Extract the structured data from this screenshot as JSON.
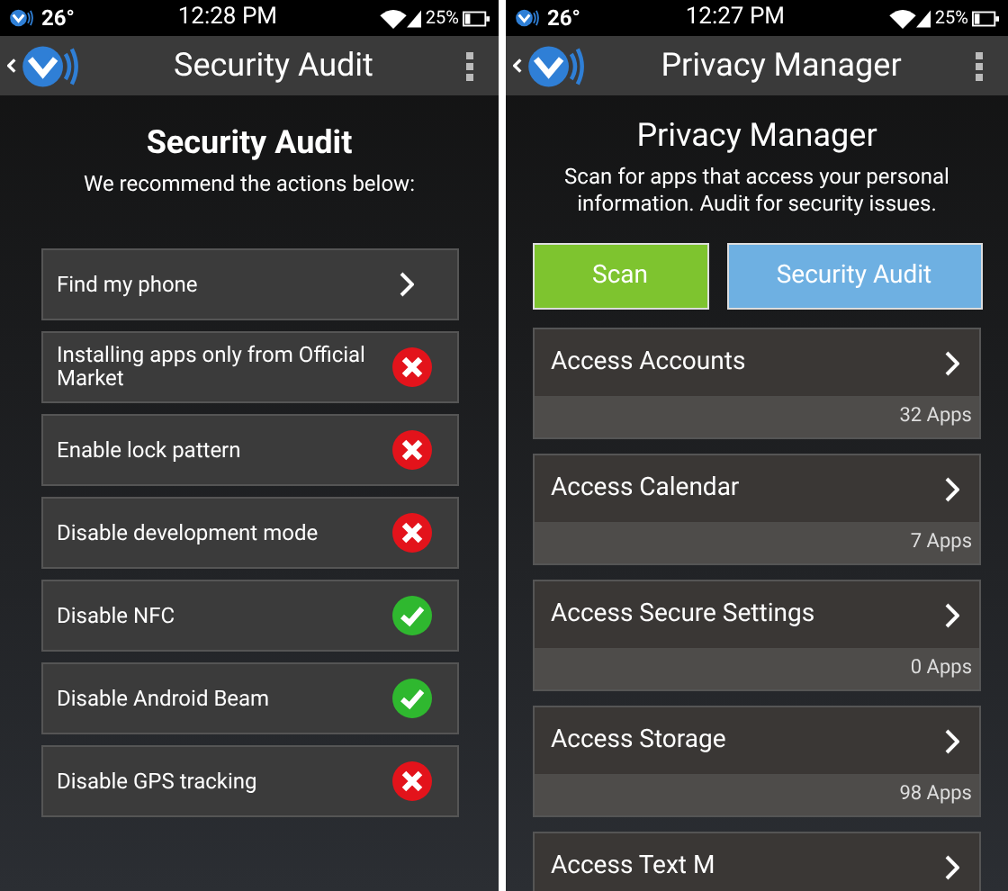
{
  "screens": [
    {
      "kind": "audit",
      "status_bar": {
        "temperature": "26°",
        "time": "12:28 PM",
        "battery": "25%"
      },
      "app_bar": {
        "title": "Security Audit"
      },
      "heading": "Security Audit",
      "subtitle": "We recommend the actions below:",
      "items": [
        {
          "kind": "link",
          "label": "Find my phone"
        },
        {
          "kind": "check",
          "label": "Installing apps only from Official Market",
          "ok": false
        },
        {
          "kind": "check",
          "label": "Enable lock pattern",
          "ok": false
        },
        {
          "kind": "check",
          "label": "Disable development mode",
          "ok": false
        },
        {
          "kind": "check",
          "label": "Disable NFC",
          "ok": true
        },
        {
          "kind": "check",
          "label": "Disable Android Beam",
          "ok": true
        },
        {
          "kind": "check",
          "label": "Disable GPS tracking",
          "ok": false
        }
      ]
    },
    {
      "kind": "privacy",
      "status_bar": {
        "temperature": "26°",
        "time": "12:27 PM",
        "battery": "25%"
      },
      "app_bar": {
        "title": "Privacy Manager"
      },
      "heading": "Privacy Manager",
      "subtitle": "Scan for apps that access your personal information. Audit for security issues.",
      "buttons": [
        {
          "kind": "scan",
          "label": "Scan"
        },
        {
          "kind": "audit",
          "label": "Security Audit"
        }
      ],
      "items": [
        {
          "label": "Access Accounts",
          "count": "32 Apps"
        },
        {
          "label": "Access Calendar",
          "count": "7 Apps"
        },
        {
          "label": "Access Secure Settings",
          "count": "0 Apps"
        },
        {
          "label": "Access Storage",
          "count": "98 Apps"
        },
        {
          "label": "Access Text M"
        }
      ]
    }
  ]
}
